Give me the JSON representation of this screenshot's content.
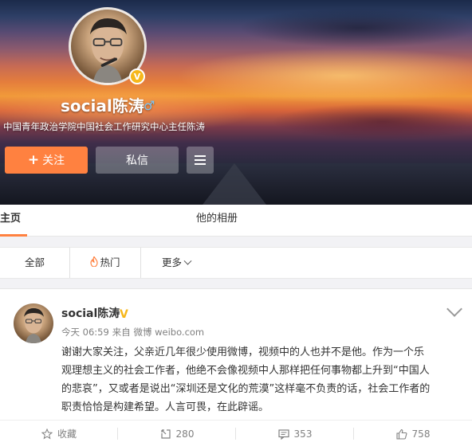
{
  "profile": {
    "name": "social陈涛",
    "gender_icon": "male-icon",
    "description": "中国青年政治学院中国社会工作研究中心主任陈涛",
    "verified_badge": "V"
  },
  "buttons": {
    "follow": "关注",
    "follow_icon": "plus-icon",
    "message": "私信",
    "menu_icon": "hamburger-icon"
  },
  "profile_tabs": {
    "home": "主页",
    "album": "他的相册"
  },
  "filter_tabs": {
    "all": "全部",
    "hot": "热门",
    "more": "更多"
  },
  "post": {
    "author": "social陈涛",
    "verified": "V",
    "time": "今天 06:59",
    "source": "来自 微博 weibo.com",
    "lines": [
      "谢谢大家关注，父亲近几年很少使用微博，视频中的人也并不是他。作为一个乐",
      "观理想主义的社会工作者，他绝不会像视频中人那样把任何事物都上升到“中国人",
      "的悲哀”，又或者是说出“深圳还是文化的荒漠”这样毫不负责的话，社会工作者的",
      "职责恰恰是构建希望。人言可畏，在此辟谣。"
    ]
  },
  "actions": {
    "favorite": "收藏",
    "forward": "280",
    "comment": "353",
    "like": "758"
  },
  "colors": {
    "accent": "#ff8140",
    "verified": "#f6b71b",
    "gender": "#7ec3f0"
  }
}
